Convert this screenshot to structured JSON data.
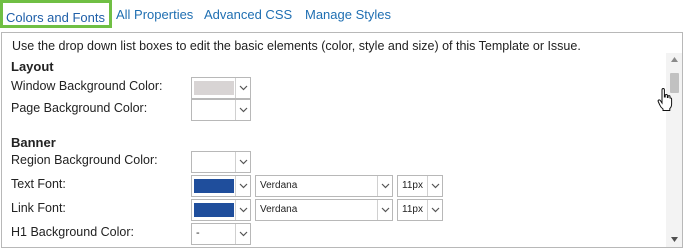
{
  "tabs": [
    {
      "label": "Colors and Fonts",
      "active": true
    },
    {
      "label": "All Properties",
      "active": false
    },
    {
      "label": "Advanced CSS",
      "active": false
    },
    {
      "label": "Manage Styles",
      "active": false
    }
  ],
  "intro": "Use the drop down list boxes to edit the basic elements (color, style and size) of this Template or Issue.",
  "sections": {
    "layout": {
      "title": "Layout",
      "rows": [
        {
          "label": "Window Background Color:",
          "color": "#d8d4d4"
        },
        {
          "label": "Page Background Color:",
          "color": "#ffffff"
        }
      ]
    },
    "banner": {
      "title": "Banner",
      "rows": [
        {
          "label": "Region Background Color:",
          "color": "#ffffff"
        },
        {
          "label": "Text Font:",
          "color": "#1f4e9c",
          "font": "Verdana",
          "size": "11px"
        },
        {
          "label": "Link Font:",
          "color": "#1f4e9c",
          "font": "Verdana",
          "size": "11px"
        },
        {
          "label": "H1 Background Color:",
          "value": "-"
        }
      ]
    }
  },
  "colors": {
    "accent_tab_border": "#70bf44",
    "link": "#1f6fb2"
  },
  "icons": [
    "chevron-down-icon",
    "scroll-up-icon",
    "scroll-down-icon",
    "hand-cursor-icon"
  ]
}
